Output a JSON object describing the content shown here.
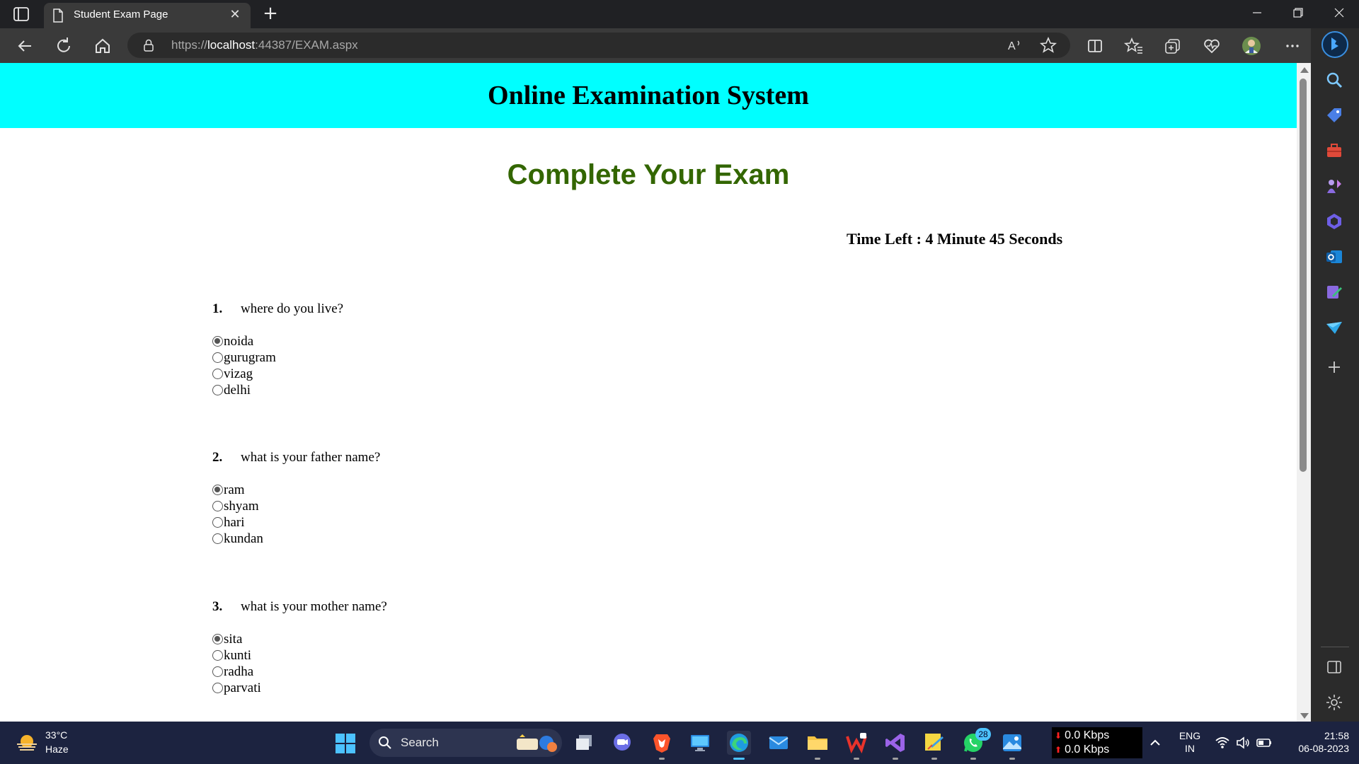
{
  "browser": {
    "tab_title": "Student Exam Page",
    "url_prefix": "https://",
    "url_host": "localhost",
    "url_rest": ":44387/EXAM.aspx"
  },
  "page": {
    "banner_title": "Online Examination System",
    "subtitle": "Complete Your Exam",
    "timer": "Time Left : 4 Minute 45 Seconds",
    "banner_color": "#00ffff",
    "subtitle_color": "#336600"
  },
  "questions": [
    {
      "number": "1.",
      "text": "where do you live?",
      "options": [
        "noida",
        "gurugram",
        "vizag",
        "delhi"
      ],
      "selected": 0
    },
    {
      "number": "2.",
      "text": "what is your father name?",
      "options": [
        "ram",
        "shyam",
        "hari",
        "kundan"
      ],
      "selected": 0
    },
    {
      "number": "3.",
      "text": "what is your mother name?",
      "options": [
        "sita",
        "kunti",
        "radha",
        "parvati"
      ],
      "selected": 0
    }
  ],
  "taskbar": {
    "weather_temp": "33°C",
    "weather_cond": "Haze",
    "search_label": "Search",
    "whatsapp_badge": "28",
    "net_down": "0.0 Kbps",
    "net_up": "0.0 Kbps",
    "lang_1": "ENG",
    "lang_2": "IN",
    "time": "21:58",
    "date": "06-08-2023"
  }
}
